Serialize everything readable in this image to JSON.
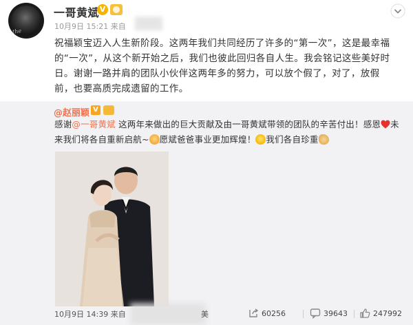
{
  "post": {
    "author": "一哥黄斌",
    "verified_badge": "V",
    "meta_prefix": "10月9日 15:21 来自",
    "text": "祝福颖宝迈入人生新阶段。这两年我们共同经历了许多的“第一次”，这是最幸福的“一次”，从这个新开始之后，我们也彼此回归各自人生。我会铭记这些美好时日。谢谢一路并肩的团队小伙伴这两年多的努力，可以放个假了，对了，放假前，也要高质完成遗留的工作。"
  },
  "repost": {
    "author": "@赵丽颖",
    "verified_badge": "V",
    "text_1": "感谢",
    "mention": "@一哥黄斌",
    "text_2": " 这两年来做出的巨大贡献及由一哥黄斌带领的团队的辛苦付出！感恩",
    "text_3": "未来我们将各自重新启航~",
    "text_4": "愿斌爸爸事业更加辉煌！",
    "text_5": "我们各自珍重",
    "footer_time": "10月9日 14:39 来自",
    "footer_tail": "美",
    "actions": {
      "shares": "60256",
      "comments": "39643",
      "likes": "247992"
    }
  },
  "icons": [
    "avatar",
    "verified-icon",
    "level-icon",
    "dropdown-chevron-icon",
    "heart-emoji-icon",
    "cat-emoji-icon",
    "smile-emoji-icon",
    "hands-emoji-icon",
    "share-icon",
    "comment-icon",
    "like-icon"
  ],
  "colors": {
    "mention": "#eb7350",
    "badge": "#f6b600",
    "repost_bg": "#f2f2f5"
  }
}
